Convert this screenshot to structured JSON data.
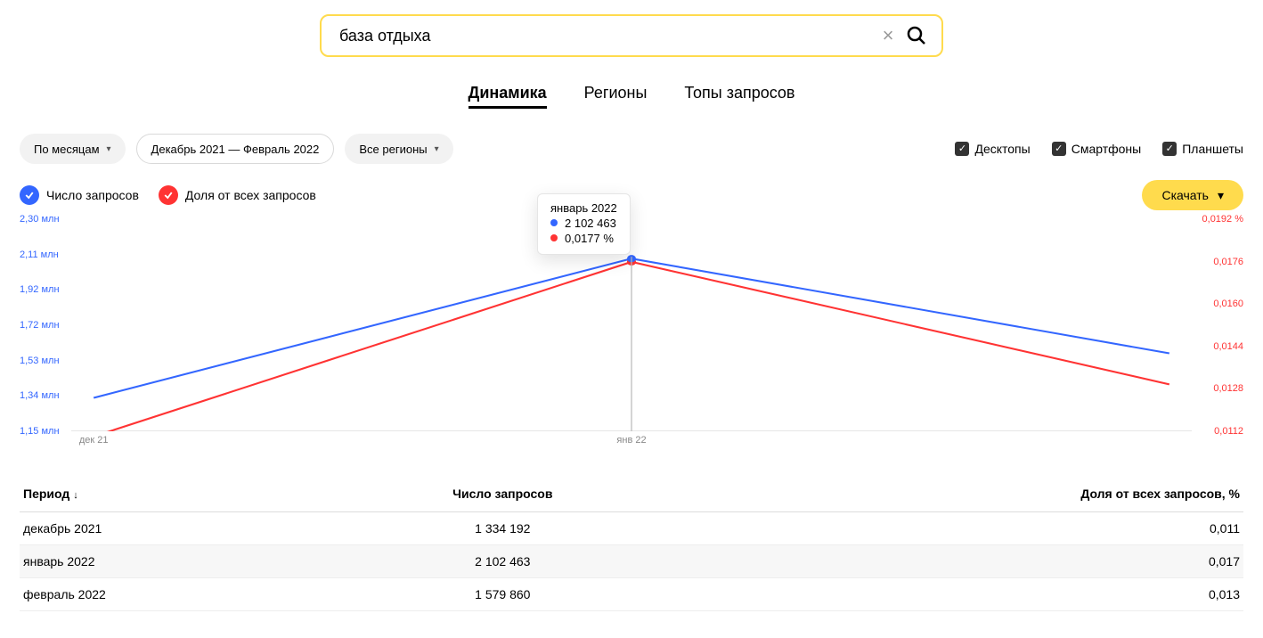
{
  "search": {
    "value": "база отдыха"
  },
  "tabs": [
    {
      "label": "Динамика",
      "active": true
    },
    {
      "label": "Регионы",
      "active": false
    },
    {
      "label": "Топы запросов",
      "active": false
    }
  ],
  "filters": {
    "period_mode": "По месяцам",
    "date_range": "Декабрь 2021 — Февраль 2022",
    "region": "Все регионы"
  },
  "devices": [
    {
      "label": "Десктопы",
      "checked": true
    },
    {
      "label": "Смартфоны",
      "checked": true
    },
    {
      "label": "Планшеты",
      "checked": true
    }
  ],
  "legend": {
    "count": "Число запросов",
    "share": "Доля от всех запросов"
  },
  "download_label": "Скачать",
  "chart_data": {
    "type": "line",
    "x": [
      "декабрь 2021",
      "январь 2022",
      "февраль 2022"
    ],
    "x_ticks": [
      "дек 21",
      "янв 22"
    ],
    "series": [
      {
        "name": "Число запросов",
        "color": "#3366ff",
        "axis": "left",
        "values": [
          1334192,
          2102463,
          1579860
        ]
      },
      {
        "name": "Доля от всех запросов",
        "color": "#ff3333",
        "axis": "right",
        "values": [
          0.011,
          0.0177,
          0.013
        ]
      }
    ],
    "y_left": {
      "label": "",
      "ticks": [
        "2,30 млн",
        "2,11 млн",
        "1,92 млн",
        "1,72 млн",
        "1,53 млн",
        "1,34 млн",
        "1,15 млн"
      ],
      "min": 1150000,
      "max": 2300000
    },
    "y_right": {
      "label": "",
      "ticks": [
        "0,0192 %",
        "0,0176",
        "0,0160",
        "0,0144",
        "0,0128",
        "0,0112"
      ],
      "min": 0.0112,
      "max": 0.0192
    },
    "tooltip": {
      "date": "январь 2022",
      "rows": [
        {
          "color": "#3366ff",
          "value": "2 102 463"
        },
        {
          "color": "#ff3333",
          "value": "0,0177 %"
        }
      ]
    }
  },
  "table": {
    "headers": {
      "period": "Период",
      "count": "Число запросов",
      "share": "Доля от всех запросов, %"
    },
    "rows": [
      {
        "period": "декабрь 2021",
        "count": "1 334 192",
        "share": "0,011"
      },
      {
        "period": "январь 2022",
        "count": "2 102 463",
        "share": "0,017"
      },
      {
        "period": "февраль 2022",
        "count": "1 579 860",
        "share": "0,013"
      }
    ]
  }
}
